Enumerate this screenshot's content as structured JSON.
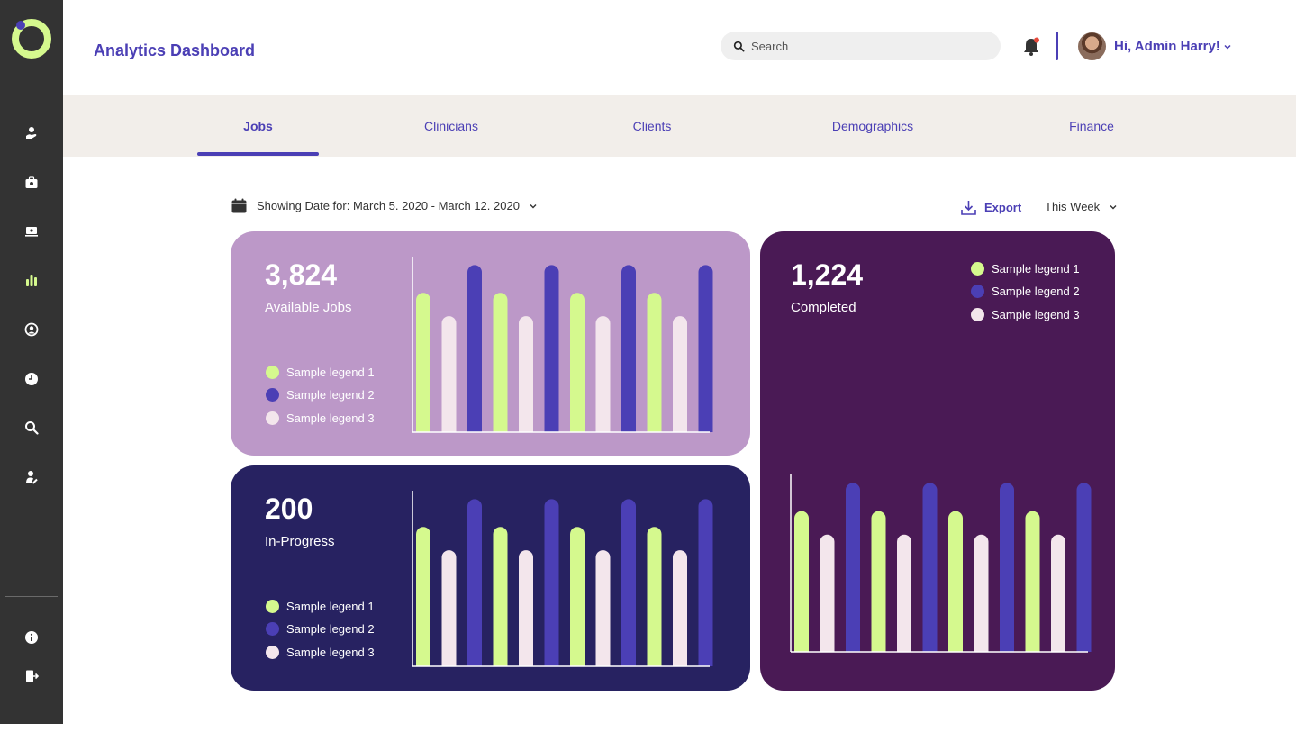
{
  "colors": {
    "accent": "#4b3fb5",
    "sidebar": "#333333",
    "lime": "#d5f98e",
    "indigo": "#4b3fb5",
    "blush": "#f3e6ec",
    "card_jobs": "#bc98c8",
    "card_progress": "#272261",
    "card_completed": "#4a1a55"
  },
  "sidebar": {
    "icons": [
      "medical-hand-icon",
      "briefcase-icon",
      "monitor-icon",
      "bar-chart-icon",
      "user-circle-icon",
      "clock-icon",
      "search-icon",
      "user-edit-icon"
    ],
    "bottom_icons": [
      "info-icon",
      "logout-icon"
    ],
    "active": "bar-chart-icon"
  },
  "header": {
    "title": "Analytics Dashboard",
    "search_placeholder": "Search",
    "greeting": "Hi, Admin Harry!"
  },
  "tabs": [
    {
      "label": "Jobs",
      "active": true
    },
    {
      "label": "Clinicians",
      "active": false
    },
    {
      "label": "Clients",
      "active": false
    },
    {
      "label": "Demographics",
      "active": false
    },
    {
      "label": "Finance",
      "active": false
    }
  ],
  "controls": {
    "date_label": "Showing Date for: March 5. 2020 - March 12. 2020",
    "export_label": "Export",
    "period_label": "This Week"
  },
  "cards": {
    "jobs": {
      "value": "3,824",
      "label": "Available Jobs",
      "legend": [
        "Sample legend 1",
        "Sample legend 2",
        "Sample legend 3"
      ]
    },
    "progress": {
      "value": "200",
      "label": "In-Progress",
      "legend": [
        "Sample legend 1",
        "Sample legend 2",
        "Sample legend 3"
      ]
    },
    "completed": {
      "value": "1,224",
      "label": "Completed",
      "legend": [
        "Sample legend 1",
        "Sample legend 2",
        "Sample legend 3"
      ]
    }
  },
  "chart_data": [
    {
      "type": "bar",
      "chart": "jobs",
      "series": [
        {
          "name": "Sample legend 1",
          "values": [
            6,
            6,
            6,
            6
          ]
        },
        {
          "name": "Sample legend 2",
          "values": [
            7.2,
            7.2,
            7.2,
            7.2
          ]
        },
        {
          "name": "Sample legend 3",
          "values": [
            5,
            5,
            5,
            5
          ]
        }
      ],
      "bar_order": [
        "Sample legend 1",
        "Sample legend 3",
        "Sample legend 2"
      ],
      "ylim": [
        0,
        10
      ]
    },
    {
      "type": "bar",
      "chart": "progress",
      "series": [
        {
          "name": "Sample legend 1",
          "values": [
            6,
            6,
            6,
            6
          ]
        },
        {
          "name": "Sample legend 2",
          "values": [
            7.2,
            7.2,
            7.2,
            7.2
          ]
        },
        {
          "name": "Sample legend 3",
          "values": [
            5,
            5,
            5,
            5
          ]
        }
      ],
      "bar_order": [
        "Sample legend 1",
        "Sample legend 3",
        "Sample legend 2"
      ],
      "ylim": [
        0,
        10
      ]
    },
    {
      "type": "bar",
      "chart": "completed",
      "series": [
        {
          "name": "Sample legend 1",
          "values": [
            6,
            6,
            6,
            6
          ]
        },
        {
          "name": "Sample legend 2",
          "values": [
            7.2,
            7.2,
            7.2,
            7.2
          ]
        },
        {
          "name": "Sample legend 3",
          "values": [
            5,
            5,
            5,
            5
          ]
        }
      ],
      "bar_order": [
        "Sample legend 1",
        "Sample legend 3",
        "Sample legend 2"
      ],
      "ylim": [
        0,
        10
      ]
    }
  ]
}
